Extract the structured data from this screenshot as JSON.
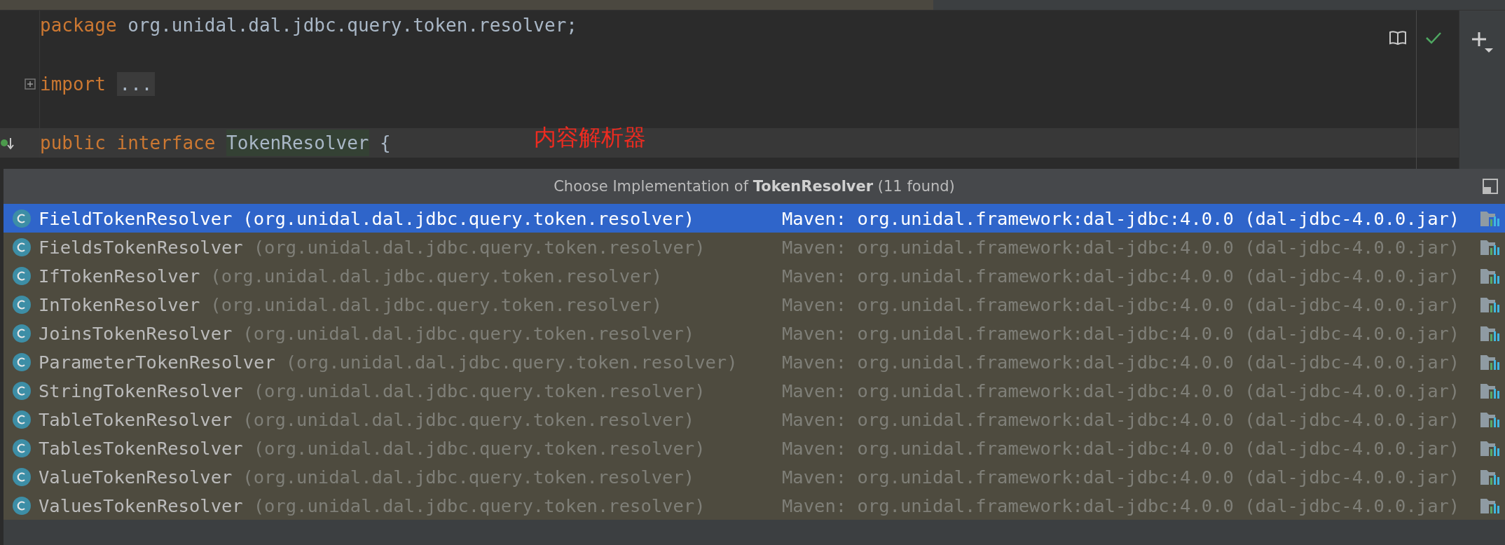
{
  "editor": {
    "lines": [
      {
        "kind": "code",
        "fold": false,
        "current": false,
        "implemented_marker": false,
        "tokens": [
          {
            "kind": "keyword",
            "text": "package"
          },
          {
            "kind": "plain",
            "text": "org.unidal.dal.jdbc.query.token.resolver"
          },
          {
            "kind": "punct",
            "text": ";"
          }
        ]
      },
      {
        "kind": "blank"
      },
      {
        "kind": "code",
        "fold": true,
        "current": false,
        "implemented_marker": false,
        "tokens": [
          {
            "kind": "keyword",
            "text": "import"
          },
          {
            "kind": "folded",
            "text": "..."
          }
        ]
      },
      {
        "kind": "blank"
      },
      {
        "kind": "code",
        "fold": false,
        "current": true,
        "implemented_marker": true,
        "tokens": [
          {
            "kind": "keyword",
            "text": "public"
          },
          {
            "kind": "keyword",
            "text": "interface"
          },
          {
            "kind": "highlight",
            "text": "TokenResolver"
          },
          {
            "kind": "plain",
            "text": "{"
          }
        ]
      }
    ],
    "annotation": "内容解析器"
  },
  "popup": {
    "title": "Choose Implementation of **TokenResolver** (11 found)",
    "rows": [
      {
        "name": "FieldTokenResolver",
        "package": "(org.unidal.dal.jdbc.query.token.resolver)",
        "location": "Maven: org.unidal.framework:dal-jdbc:4.0.0 (dal-jdbc-4.0.0.jar)",
        "selected": true
      },
      {
        "name": "FieldsTokenResolver",
        "package": "(org.unidal.dal.jdbc.query.token.resolver)",
        "location": "Maven: org.unidal.framework:dal-jdbc:4.0.0 (dal-jdbc-4.0.0.jar)",
        "selected": false
      },
      {
        "name": "IfTokenResolver",
        "package": "(org.unidal.dal.jdbc.query.token.resolver)",
        "location": "Maven: org.unidal.framework:dal-jdbc:4.0.0 (dal-jdbc-4.0.0.jar)",
        "selected": false
      },
      {
        "name": "InTokenResolver",
        "package": "(org.unidal.dal.jdbc.query.token.resolver)",
        "location": "Maven: org.unidal.framework:dal-jdbc:4.0.0 (dal-jdbc-4.0.0.jar)",
        "selected": false
      },
      {
        "name": "JoinsTokenResolver",
        "package": "(org.unidal.dal.jdbc.query.token.resolver)",
        "location": "Maven: org.unidal.framework:dal-jdbc:4.0.0 (dal-jdbc-4.0.0.jar)",
        "selected": false
      },
      {
        "name": "ParameterTokenResolver",
        "package": "(org.unidal.dal.jdbc.query.token.resolver)",
        "location": "Maven: org.unidal.framework:dal-jdbc:4.0.0 (dal-jdbc-4.0.0.jar)",
        "selected": false
      },
      {
        "name": "StringTokenResolver",
        "package": "(org.unidal.dal.jdbc.query.token.resolver)",
        "location": "Maven: org.unidal.framework:dal-jdbc:4.0.0 (dal-jdbc-4.0.0.jar)",
        "selected": false
      },
      {
        "name": "TableTokenResolver",
        "package": "(org.unidal.dal.jdbc.query.token.resolver)",
        "location": "Maven: org.unidal.framework:dal-jdbc:4.0.0 (dal-jdbc-4.0.0.jar)",
        "selected": false
      },
      {
        "name": "TablesTokenResolver",
        "package": "(org.unidal.dal.jdbc.query.token.resolver)",
        "location": "Maven: org.unidal.framework:dal-jdbc:4.0.0 (dal-jdbc-4.0.0.jar)",
        "selected": false
      },
      {
        "name": "ValueTokenResolver",
        "package": "(org.unidal.dal.jdbc.query.token.resolver)",
        "location": "Maven: org.unidal.framework:dal-jdbc:4.0.0 (dal-jdbc-4.0.0.jar)",
        "selected": false
      },
      {
        "name": "ValuesTokenResolver",
        "package": "(org.unidal.dal.jdbc.query.token.resolver)",
        "location": "Maven: org.unidal.framework:dal-jdbc:4.0.0 (dal-jdbc-4.0.0.jar)",
        "selected": false
      }
    ]
  }
}
